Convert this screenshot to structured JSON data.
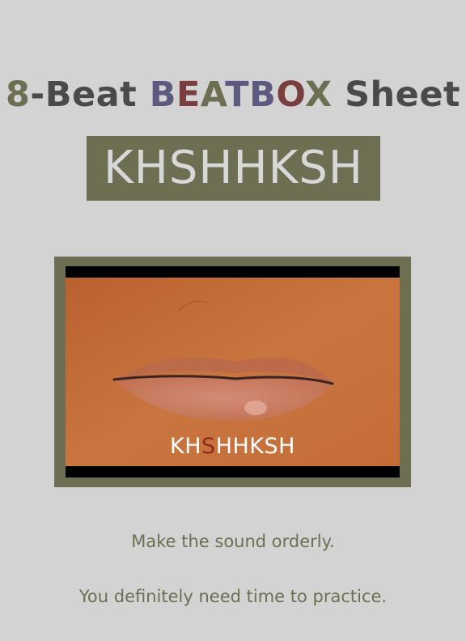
{
  "title": {
    "parts": [
      {
        "text": "8",
        "color": "#6e6e52"
      },
      {
        "text": "-Beat ",
        "color": "#4a4a4a"
      },
      {
        "text": "B",
        "color": "#5c5a7e"
      },
      {
        "text": "E",
        "color": "#7a3e3e"
      },
      {
        "text": "A",
        "color": "#6e6e52"
      },
      {
        "text": "T",
        "color": "#5c5a7e"
      },
      {
        "text": "B",
        "color": "#5c5a7e"
      },
      {
        "text": "O",
        "color": "#7a3e3e"
      },
      {
        "text": "X",
        "color": "#6e6e52"
      },
      {
        "text": " Sheet",
        "color": "#4a4a4a"
      }
    ]
  },
  "pattern_box": {
    "text": "KHSHHKSH"
  },
  "video": {
    "subtitle_parts": [
      {
        "text": "KH",
        "color": "#ffffff"
      },
      {
        "text": "S",
        "color": "#8b2a1f"
      },
      {
        "text": "HHKSH",
        "color": "#ffffff"
      }
    ]
  },
  "notes": [
    "Make the sound orderly.",
    "You definitely need time to practice."
  ],
  "colors": {
    "background": "#d3d3d3",
    "olive": "#6e6e52",
    "skin": "#c7703e"
  }
}
